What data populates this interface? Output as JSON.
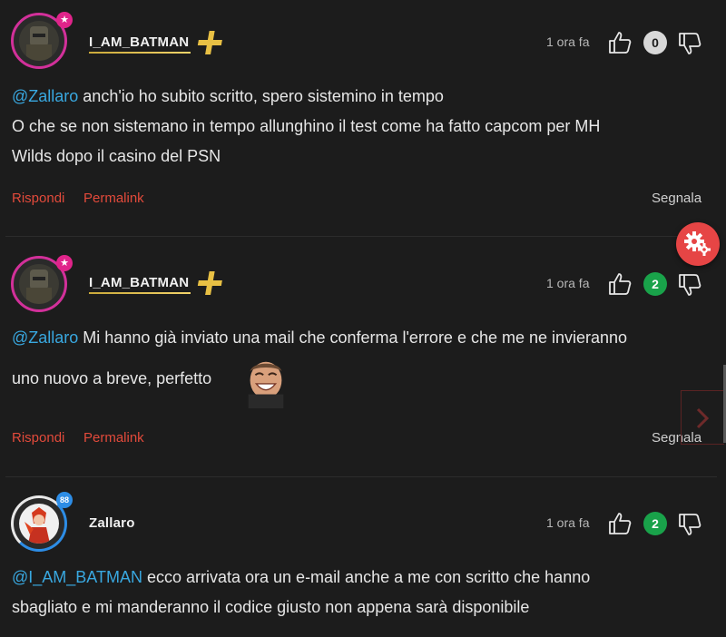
{
  "comments": [
    {
      "username": "I_AM_BATMAN",
      "time": "1 ora fa",
      "score": "0",
      "mention": "@Zallaro",
      "text_line1": " anch'io ho subito scritto, spero sistemino in tempo",
      "text_line2": "O che se non sistemano in tempo allunghino il test come ha fatto capcom per MH",
      "text_line3": "Wilds dopo il casino del PSN",
      "reply": "Rispondi",
      "permalink": "Permalink",
      "report": "Segnala"
    },
    {
      "username": "I_AM_BATMAN",
      "time": "1 ora fa",
      "score": "2",
      "mention": "@Zallaro",
      "text_line1": " Mi hanno già inviato una mail che conferma l'errore e che me ne invieranno",
      "text_line2": "uno nuovo a breve, perfetto",
      "reply": "Rispondi",
      "permalink": "Permalink",
      "report": "Segnala"
    },
    {
      "username": "Zallaro",
      "time": "1 ora fa",
      "score": "2",
      "level": "88",
      "mention": "@I_AM_BATMAN",
      "text_line1": " ecco arrivata ora un e-mail anche a me con scritto che hanno",
      "text_line2": "sbagliato e mi manderanno il codice giusto non appena sarà disponibile"
    }
  ],
  "colors": {
    "background": "#1c1c1c",
    "mention": "#39a8e0",
    "action_links": "#e24a3b",
    "score_positive": "#19a24a",
    "score_neutral": "#d8d8d8",
    "premium_ring": "#d2309a",
    "fab": "#e64545"
  },
  "icons": [
    "star-icon",
    "plus-premium-icon",
    "thumbs-up-icon",
    "thumbs-down-icon",
    "gear-icon",
    "chevron-right-icon",
    "laughing-emoji"
  ]
}
